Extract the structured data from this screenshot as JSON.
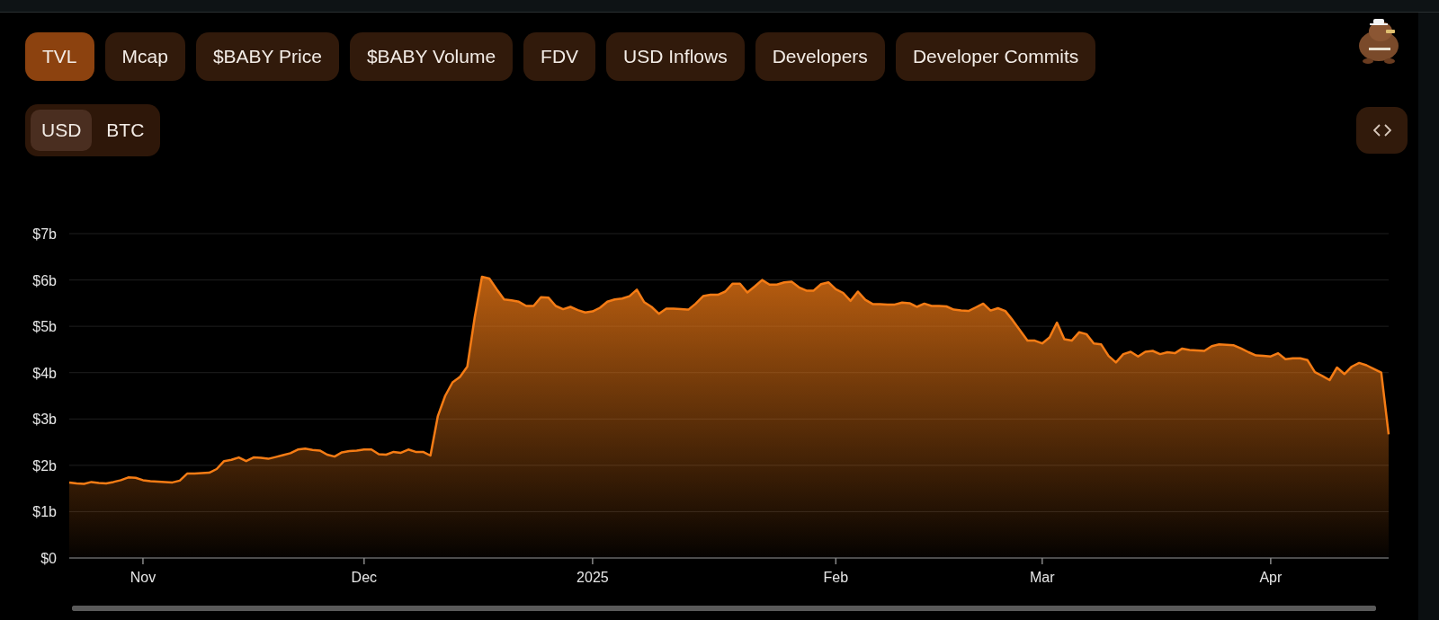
{
  "tabs": [
    {
      "label": "TVL",
      "selected": true
    },
    {
      "label": "Mcap",
      "selected": false
    },
    {
      "label": "$BABY Price",
      "selected": false
    },
    {
      "label": "$BABY Volume",
      "selected": false
    },
    {
      "label": "FDV",
      "selected": false
    },
    {
      "label": "USD Inflows",
      "selected": false
    },
    {
      "label": "Developers",
      "selected": false
    },
    {
      "label": "Developer Commits",
      "selected": false
    }
  ],
  "range_slider": {
    "level": 1
  },
  "currency": [
    {
      "label": "USD",
      "selected": true
    },
    {
      "label": "BTC",
      "selected": false
    }
  ],
  "chart": {
    "chart_data": {
      "type": "area",
      "categories": [
        null,
        null,
        null,
        null,
        null,
        null,
        null,
        null,
        null,
        null,
        "Nov",
        null,
        null,
        null,
        null,
        null,
        null,
        null,
        null,
        null,
        null,
        null,
        null,
        null,
        null,
        null,
        null,
        null,
        null,
        null,
        null,
        null,
        null,
        null,
        null,
        null,
        null,
        null,
        null,
        null,
        "Dec",
        null,
        null,
        null,
        null,
        null,
        null,
        null,
        null,
        null,
        null,
        null,
        null,
        null,
        null,
        null,
        null,
        null,
        null,
        null,
        null,
        null,
        null,
        null,
        null,
        null,
        null,
        null,
        null,
        null,
        null,
        "2025",
        null,
        null,
        null,
        null,
        null,
        null,
        null,
        null,
        null,
        null,
        null,
        null,
        null,
        null,
        null,
        null,
        null,
        null,
        null,
        null,
        null,
        null,
        null,
        null,
        null,
        null,
        null,
        null,
        null,
        null,
        null,
        null,
        "Feb",
        null,
        null,
        null,
        null,
        null,
        null,
        null,
        null,
        null,
        null,
        null,
        null,
        null,
        null,
        null,
        null,
        null,
        null,
        null,
        null,
        null,
        null,
        null,
        null,
        null,
        null,
        null,
        "Mar",
        null,
        null,
        null,
        null,
        null,
        null,
        null,
        null,
        null,
        null,
        null,
        null,
        null,
        null,
        null,
        null,
        null,
        null,
        null,
        null,
        null,
        null,
        null,
        null,
        null,
        null,
        null,
        null,
        null,
        null,
        "Apr",
        null,
        null,
        null,
        null,
        null,
        null,
        null,
        null,
        null,
        null,
        null,
        null,
        null,
        null,
        null,
        null
      ],
      "series": [
        {
          "color": "#f57c15",
          "values": [
            1.63,
            1.61,
            1.6,
            1.64,
            1.62,
            1.61,
            1.64,
            1.68,
            1.74,
            1.73,
            1.68,
            1.66,
            1.65,
            1.64,
            1.63,
            1.67,
            1.82,
            1.82,
            1.83,
            1.84,
            1.92,
            2.09,
            2.12,
            2.17,
            2.09,
            2.17,
            2.16,
            2.14,
            2.18,
            2.22,
            2.26,
            2.34,
            2.36,
            2.33,
            2.32,
            2.23,
            2.19,
            2.28,
            2.31,
            2.32,
            2.34,
            2.34,
            2.24,
            2.23,
            2.29,
            2.27,
            2.34,
            2.29,
            2.29,
            2.21,
            3.06,
            3.5,
            3.79,
            3.91,
            4.13,
            5.19,
            6.07,
            6.03,
            5.8,
            5.58,
            5.56,
            5.53,
            5.44,
            5.44,
            5.63,
            5.62,
            5.44,
            5.37,
            5.42,
            5.35,
            5.3,
            5.32,
            5.4,
            5.53,
            5.58,
            5.6,
            5.65,
            5.79,
            5.52,
            5.42,
            5.27,
            5.38,
            5.38,
            5.37,
            5.36,
            5.49,
            5.65,
            5.68,
            5.68,
            5.75,
            5.92,
            5.92,
            5.73,
            5.86,
            6.0,
            5.9,
            5.9,
            5.95,
            5.96,
            5.84,
            5.77,
            5.77,
            5.91,
            5.95,
            5.8,
            5.72,
            5.55,
            5.75,
            5.57,
            5.48,
            5.48,
            5.47,
            5.47,
            5.51,
            5.5,
            5.42,
            5.49,
            5.44,
            5.44,
            5.43,
            5.36,
            5.34,
            5.33,
            5.41,
            5.49,
            5.34,
            5.39,
            5.33,
            5.13,
            4.91,
            4.69,
            4.69,
            4.63,
            4.76,
            5.08,
            4.72,
            4.69,
            4.87,
            4.83,
            4.63,
            4.61,
            4.36,
            4.22,
            4.4,
            4.45,
            4.35,
            4.45,
            4.47,
            4.4,
            4.44,
            4.42,
            4.52,
            4.49,
            4.48,
            4.47,
            4.57,
            4.61,
            4.6,
            4.59,
            4.52,
            4.44,
            4.37,
            4.36,
            4.35,
            4.42,
            4.29,
            4.31,
            4.31,
            4.27,
            4.01,
            3.93,
            3.84,
            4.11,
            3.97,
            4.13,
            4.21,
            4.16,
            4.08,
            4.0,
            2.67
          ]
        }
      ],
      "ylim": [
        0,
        7
      ],
      "grid": true,
      "yticks": [
        {
          "value": 0,
          "label": "$0"
        },
        {
          "value": 1,
          "label": "$1b"
        },
        {
          "value": 2,
          "label": "$2b"
        },
        {
          "value": 3,
          "label": "$3b"
        },
        {
          "value": 4,
          "label": "$4b"
        },
        {
          "value": 5,
          "label": "$5b"
        },
        {
          "value": 6,
          "label": "$6b"
        },
        {
          "value": 7,
          "label": "$7b"
        }
      ]
    }
  }
}
